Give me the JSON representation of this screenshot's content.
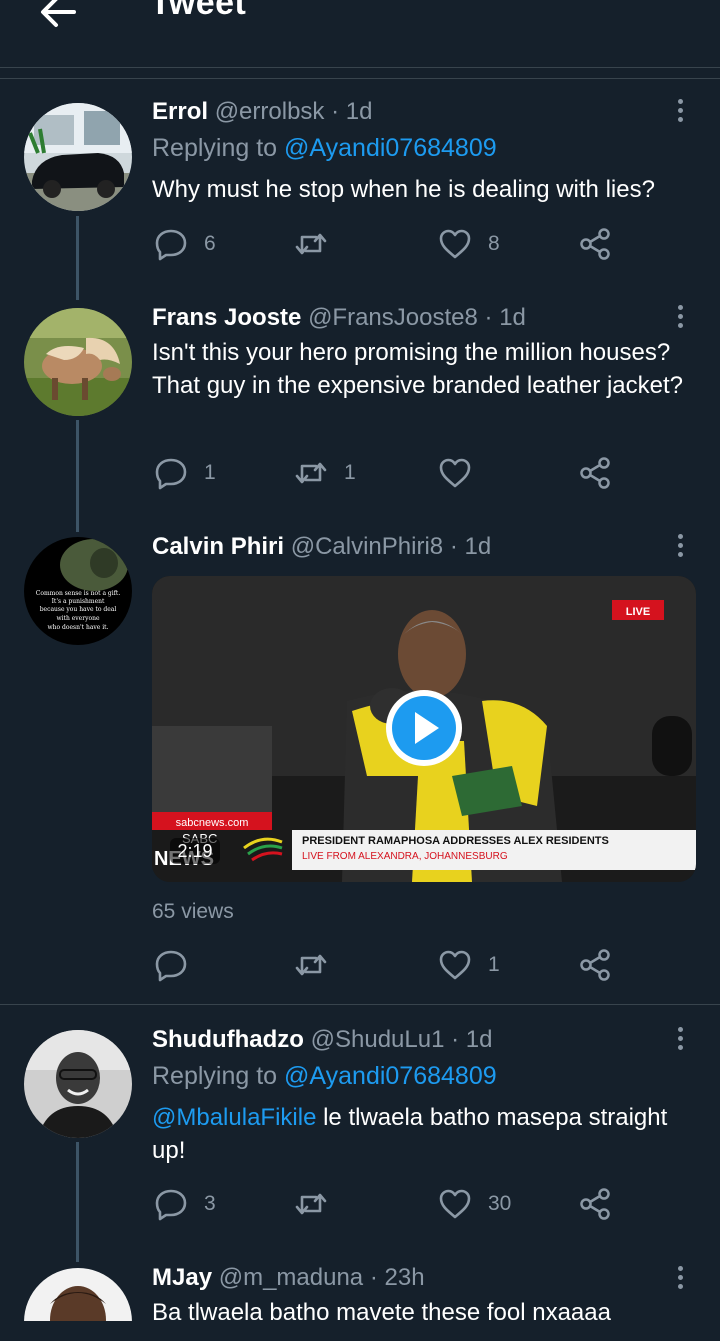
{
  "header": {
    "title": "Tweet"
  },
  "tweets": [
    {
      "name": "Errol",
      "handle": "@errolbsk",
      "sep": "·",
      "time": "1d",
      "replying_prefix": "Replying to",
      "replying_handle": "@Ayandi07684809",
      "text": "Why must he stop when he is dealing with lies?",
      "replies": "6",
      "retweets": "",
      "likes": "8"
    },
    {
      "name": "Frans Jooste",
      "handle": "@FransJooste8",
      "sep": "·",
      "time": "1d",
      "text": "Isn't this your hero promising the million houses? That guy in the expensive branded leather jacket?",
      "replies": "1",
      "retweets": "1",
      "likes": ""
    },
    {
      "name": "Calvin Phiri",
      "handle": "@CalvinPhiri8",
      "sep": "·",
      "time": "1d",
      "avatar_text": [
        "Common sense is not a gift.",
        "It's a punishment",
        "because you have to deal",
        "with everyone",
        "who doesn't have it."
      ],
      "video": {
        "live_badge": "LIVE",
        "duration": "2:19",
        "site": "sabcnews.com",
        "lower_third_title": "PRESIDENT RAMAPHOSA ADDRESSES ALEX RESIDENTS",
        "lower_third_sub": "LIVE FROM ALEXANDRA, JOHANNESBURG",
        "logo_top": "SABC",
        "logo_bottom": "NEWS"
      },
      "views": "65 views",
      "replies": "",
      "retweets": "",
      "likes": "1"
    },
    {
      "name": "Shudufhadzo",
      "handle": "@ShuduLu1",
      "sep": "·",
      "time": "1d",
      "replying_prefix": "Replying to",
      "replying_handle": "@Ayandi07684809",
      "mention": "@MbalulaFikile",
      "text": " le tlwaela batho masepa straight up!",
      "replies": "3",
      "retweets": "",
      "likes": "30"
    },
    {
      "name": "MJay",
      "handle": "@m_maduna",
      "sep": "·",
      "time": "23h",
      "text": "Ba tlwaela batho mavete these fool nxaaaa"
    }
  ],
  "colors": {
    "background": "#15202b",
    "accent": "#1d9bf0",
    "muted": "#8b98a5",
    "divider": "#38444d"
  },
  "icons": [
    "back-arrow-icon",
    "more-icon",
    "reply-icon",
    "retweet-icon",
    "like-icon",
    "share-icon",
    "play-icon"
  ]
}
